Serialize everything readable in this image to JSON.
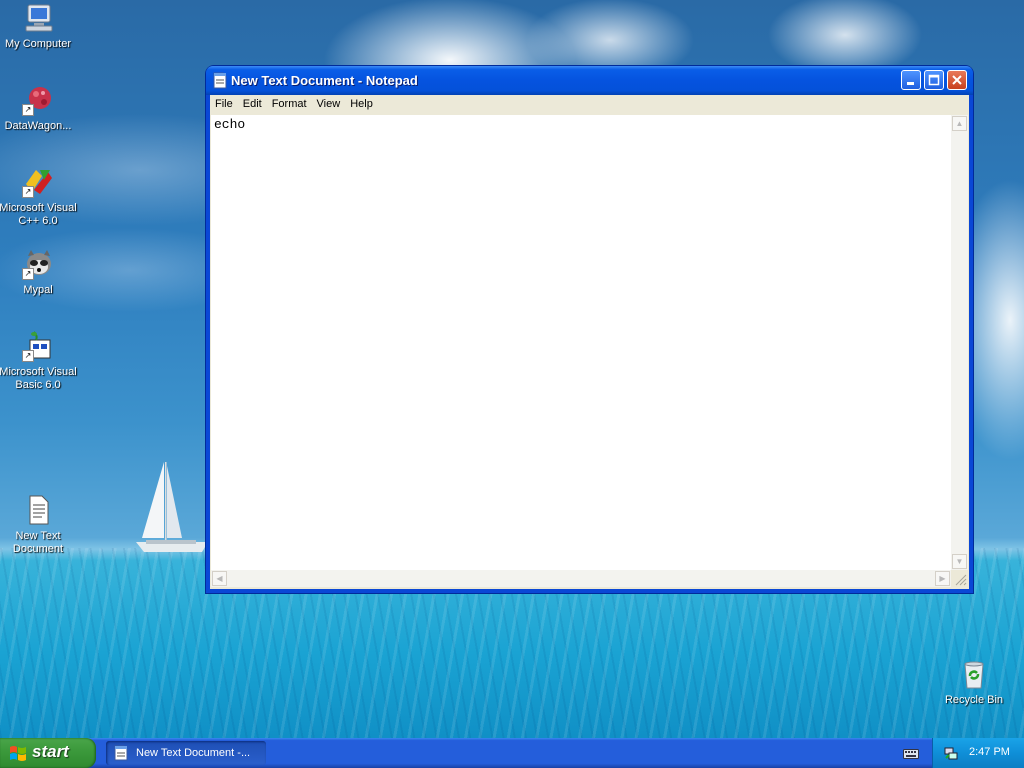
{
  "desktop": {
    "icons": [
      {
        "label": "My Computer",
        "icon": "my-computer-icon"
      },
      {
        "label": "DataWagon...",
        "icon": "datawagon-icon"
      },
      {
        "label": "Microsoft Visual C++ 6.0",
        "icon": "visual-cpp-icon"
      },
      {
        "label": "Mypal",
        "icon": "mypal-icon"
      },
      {
        "label": "Microsoft Visual Basic 6.0",
        "icon": "visual-basic-icon"
      },
      {
        "label": "New Text Document",
        "icon": "text-document-icon"
      },
      {
        "label": "Recycle Bin",
        "icon": "recycle-bin-icon"
      }
    ]
  },
  "notepad": {
    "title": "New Text Document - Notepad",
    "menu": [
      "File",
      "Edit",
      "Format",
      "View",
      "Help"
    ],
    "content": "echo"
  },
  "taskbar": {
    "start_label": "start",
    "task_label": "New Text Document -...",
    "clock": "2:47 PM"
  },
  "colors": {
    "titlebar": "#0553df",
    "taskbar": "#245edb",
    "start": "#3c9a3c",
    "tray": "#0f8fd8"
  }
}
